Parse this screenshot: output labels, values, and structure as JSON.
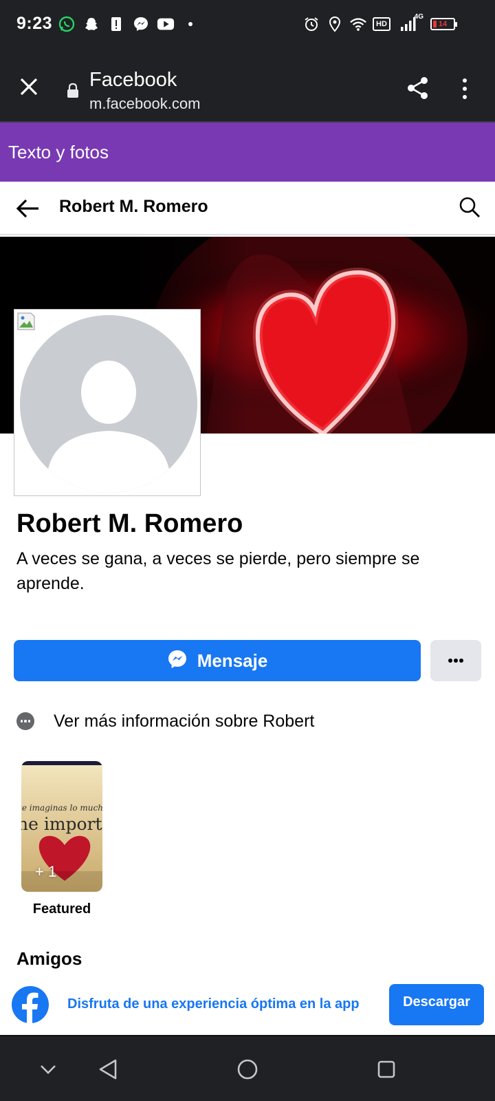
{
  "status_bar": {
    "time": "9:23",
    "battery_level": "14",
    "network": "4G",
    "hd": "HD",
    "left_icons": [
      "whatsapp-icon",
      "snapchat-icon",
      "alert-icon",
      "messenger-icon",
      "youtube-icon",
      "dot-icon"
    ],
    "right_icons": [
      "alarm-icon",
      "location-icon",
      "wifi-icon",
      "hd-icon",
      "signal-icon",
      "battery-icon"
    ]
  },
  "browser": {
    "title": "Facebook",
    "url": "m.facebook.com"
  },
  "banner_top": {
    "label": "Texto y fotos",
    "color": "#7839b3"
  },
  "header": {
    "title": "Robert M. Romero"
  },
  "profile": {
    "name": "Robert M. Romero",
    "bio": "A veces se gana, a veces se pierde, pero siempre se aprende."
  },
  "actions": {
    "message_label": "Mensaje",
    "more_label": "•••",
    "info_label": "Ver más información sobre Robert"
  },
  "featured": {
    "count": "+ 1",
    "label": "Featured",
    "card_text": [
      "te imaginas lo much",
      "ne import"
    ]
  },
  "sections": {
    "friends_title": "Amigos"
  },
  "app_banner": {
    "text": "Disfruta de una experiencia óptima en la app",
    "button_label": "Descargar"
  },
  "colors": {
    "facebook_blue": "#1877f2",
    "status_bar": "#202124",
    "button_gray": "#e4e6eb"
  }
}
